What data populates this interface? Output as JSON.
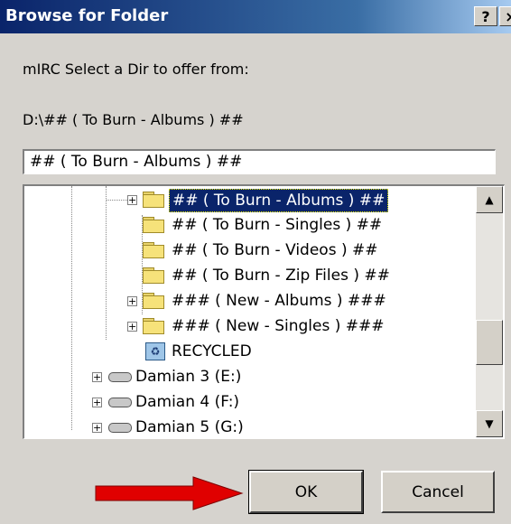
{
  "window": {
    "title": "Browse for Folder",
    "help_label": "?",
    "close_label": "×"
  },
  "prompt": "mIRC Select a Dir to offer from:",
  "current_path": "D:\\## ( To Burn - Albums ) ##",
  "folder_field": {
    "value": "## ( To Burn - Albums ) ##"
  },
  "tree": {
    "items": [
      {
        "label": "## ( To Burn - Albums ) ##",
        "icon": "folder-icon",
        "expander": "+",
        "selected": true
      },
      {
        "label": "## ( To Burn - Singles ) ##",
        "icon": "folder-icon"
      },
      {
        "label": "## ( To Burn - Videos ) ##",
        "icon": "folder-icon"
      },
      {
        "label": "## ( To Burn - Zip Files ) ##",
        "icon": "folder-icon"
      },
      {
        "label": "### ( New - Albums ) ###",
        "icon": "folder-icon",
        "expander": "+"
      },
      {
        "label": "### ( New - Singles ) ###",
        "icon": "folder-icon",
        "expander": "+"
      },
      {
        "label": "RECYCLED",
        "icon": "recycle-bin-icon"
      },
      {
        "label": "Damian 3 (E:)",
        "icon": "drive-icon",
        "expander": "+"
      },
      {
        "label": "Damian 4 (F:)",
        "icon": "drive-icon",
        "expander": "+"
      },
      {
        "label": "Damian 5 (G:)",
        "icon": "drive-icon",
        "expander": "+"
      }
    ]
  },
  "scrollbar": {
    "up": "▲",
    "down": "▼"
  },
  "buttons": {
    "ok": "OK",
    "cancel": "Cancel"
  },
  "colors": {
    "title_bar": "#0a246a",
    "selection": "#0a246a",
    "arrow": "#e00000",
    "dialog": "#d6d3ce"
  }
}
